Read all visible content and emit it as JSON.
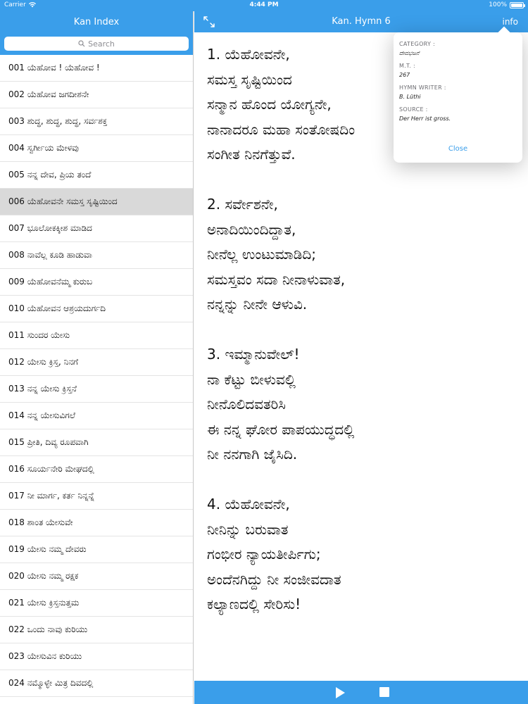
{
  "status_bar": {
    "carrier": "Carrier",
    "time": "4:44 PM",
    "battery": "100%"
  },
  "left": {
    "title": "Kan Index",
    "search_placeholder": "Search",
    "items": [
      "001 ಯೆಹೋವ ! ಯೆಹೋವ !",
      "002 ಯೆಹೋವ ಜಗದೀಶನೇ",
      "003 ಶುದ್ಧ, ಶುದ್ಧ, ಶುದ್ಧ, ಸರ್ವಶಕ್ತ",
      "004 ಸ್ವರ್ಗೀಯ ಮೇಳವು",
      "005 ನನ್ನ ದೇವ, ಪ್ರಿಯ ತಂದೆ",
      "006 ಯೆಹೋವನೇ ಸಮಸ್ತ ಸೃಷ್ಟಿಯಿಂದ",
      "007 ಭೂಲೋಕಕ್ಕೀಶ ಮಾಡಿದ",
      "008 ನಾವೆಲ್ಲ ಕೂಡಿ ಹಾಡುವಾ",
      "009 ಯೆಹೋವನೆಮ್ಮ ಕುರುಬ",
      "010 ಯೆಹೋವನ ಆಶ್ರಯದುರ್ಗದಿ",
      "011 ಸುಂದರ ಯೇಸು",
      "012 ಯೇಸು ಕ್ರಿಸ್ತ, ನಿನಗೆ",
      "013 ನನ್ನ ಯೇಸು ಕ್ರಿಸ್ತನೆ",
      "014 ನನ್ನ ಯೇಸುವಿಗಲೆ",
      "015 ಪ್ರೀತಿ, ದಿವ್ಯ ರೂಪವಾಗಿ",
      "016 ಸೂರ್ಯನೇರಿ ಮೇಘದಲ್ಲಿ",
      "017 ನೀ ಮಾರ್ಗ, ಕರ್ತ ನಿನ್ನನ್ನೆ",
      "018 ಶಾಂತ ಯೇಸುವೇ",
      "019 ಯೇಸು ನಮ್ಮ ದೇವರು",
      "020 ಯೇಸು ನಮ್ಮ ರಕ್ಷಕ",
      "021 ಯೇಸು ಕ್ರಿಸ್ತನುತ್ತಮ",
      "022 ಒಂದು ನಾವು ಕುರಿಯು",
      "023 ಯೇಸುವಿನ ಕುರಿಯು",
      "024 ನಮ್ಮೊಳ್ಳೇ ಮಿತ್ರ ದಿವದಲ್ಲಿ"
    ],
    "selected_index": 5
  },
  "right": {
    "title": "Kan. Hymn 6",
    "info_label": "info",
    "verses": [
      [
        "1. ಯೆಹೋವನೇ,",
        "ಸಮಸ್ತ ಸೃಷ್ಟಿಯಿಂದ",
        "ಸನ್ಮಾನ ಹೊಂದ ಯೋಗ್ಯನೇ,",
        "ನಾನಾದರೂ ಮಹಾ ಸಂತೋಷದಿಂ",
        "ಸಂಗೀತ ನಿನಗೆತ್ತುವೆ."
      ],
      [
        "2. ಸರ್ವೇಶನೇ,",
        "ಅನಾದಿಯಿಂದಿದ್ದಾತ,",
        "ನೀನೆಲ್ಲ ಉಂಟುಮಾಡಿದಿ;",
        "ಸಮಸ್ತವಂ ಸದಾ ನೀನಾಳುವಾತ,",
        "ನನ್ನನ್ನು ನೀನೇ ಆಳುವಿ."
      ],
      [
        "3. ಇಮ್ಮಾನುವೇಲ್!",
        "ನಾ ಕೆಟ್ಟು ಬೀಳುವಲ್ಲಿ",
        "ನೀನೊಲಿದವತರಿಸಿ",
        "ಈ ನನ್ನ ಘೋರ ಪಾಪಯುದ್ಧದಲ್ಲಿ",
        "ನೀ ನನಗಾಗಿ ಜೈಸಿದಿ."
      ],
      [
        "4. ಯೆಹೋವನೇ,",
        "ನೀನಿನ್ನು ಬರುವಾತ",
        "ಗಂಭೀರ ನ್ಯಾಯತೀರ್ಪಿಗು;",
        "ಅಂದೆನಗಿದ್ದು ನೀ ಸಂಜೀವದಾತ",
        "ಕಲ್ಯಾಣದಲ್ಲಿ ಸೇರಿಸು!"
      ]
    ]
  },
  "info_popover": {
    "category_label": "CATEGORY :",
    "category_value": "ದೇವಭಜನೆ",
    "mt_label": "M.T. :",
    "mt_value": "267",
    "writer_label": "HYMN WRITER :",
    "writer_value": "B. Lüthi",
    "source_label": "SOURCE :",
    "source_value": "Der Herr ist gross.",
    "close_label": "Close"
  },
  "colors": {
    "accent": "#3a9eea",
    "selected_row": "#d9d9d9"
  }
}
